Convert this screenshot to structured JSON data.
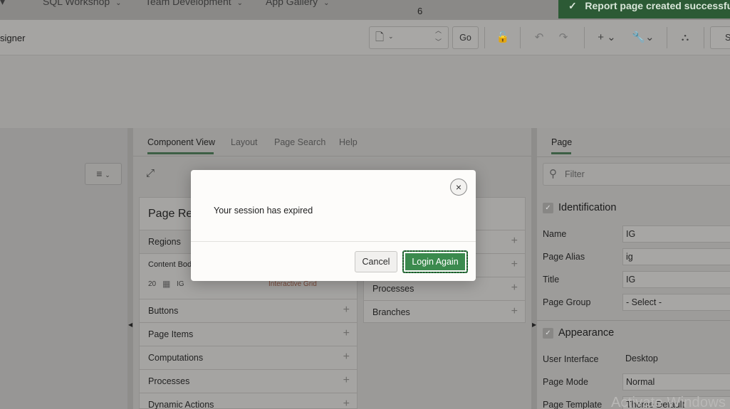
{
  "topnav": {
    "items": [
      "SQL Workshop",
      "Team Development",
      "App Gallery"
    ],
    "toast": "Report page created successfu"
  },
  "toolbar": {
    "title": "signer",
    "page_number": "6",
    "go_label": "Go",
    "cut_label": "S"
  },
  "center": {
    "tabs": [
      "Component View",
      "Layout",
      "Page Search",
      "Help"
    ],
    "page_rendering_title": "Page Rer",
    "regions_label": "Regions",
    "content_body_label": "Content Bod",
    "region_seq": "20",
    "region_name": "IG",
    "region_type": "Interactive Grid",
    "left_rows": [
      "Buttons",
      "Page Items",
      "Computations",
      "Processes",
      "Dynamic Actions"
    ],
    "right_rows": [
      "Processes",
      "Branches"
    ]
  },
  "right": {
    "tab_label": "Page",
    "filter_placeholder": "Filter",
    "identification": {
      "heading": "Identification",
      "fields": [
        {
          "label": "Name",
          "value": "IG"
        },
        {
          "label": "Page Alias",
          "value": "ig"
        },
        {
          "label": "Title",
          "value": "IG"
        },
        {
          "label": "Page Group",
          "value": "- Select -"
        }
      ]
    },
    "appearance": {
      "heading": "Appearance",
      "fields": [
        {
          "label": "User Interface",
          "value": "Desktop"
        },
        {
          "label": "Page Mode",
          "value": "Normal"
        },
        {
          "label": "Page Template",
          "value": "Theme Default"
        }
      ]
    }
  },
  "watermark": "Activate Windows",
  "modal": {
    "message": "Your session has expired",
    "cancel_label": "Cancel",
    "login_label": "Login Again",
    "close_glyph": "×"
  }
}
